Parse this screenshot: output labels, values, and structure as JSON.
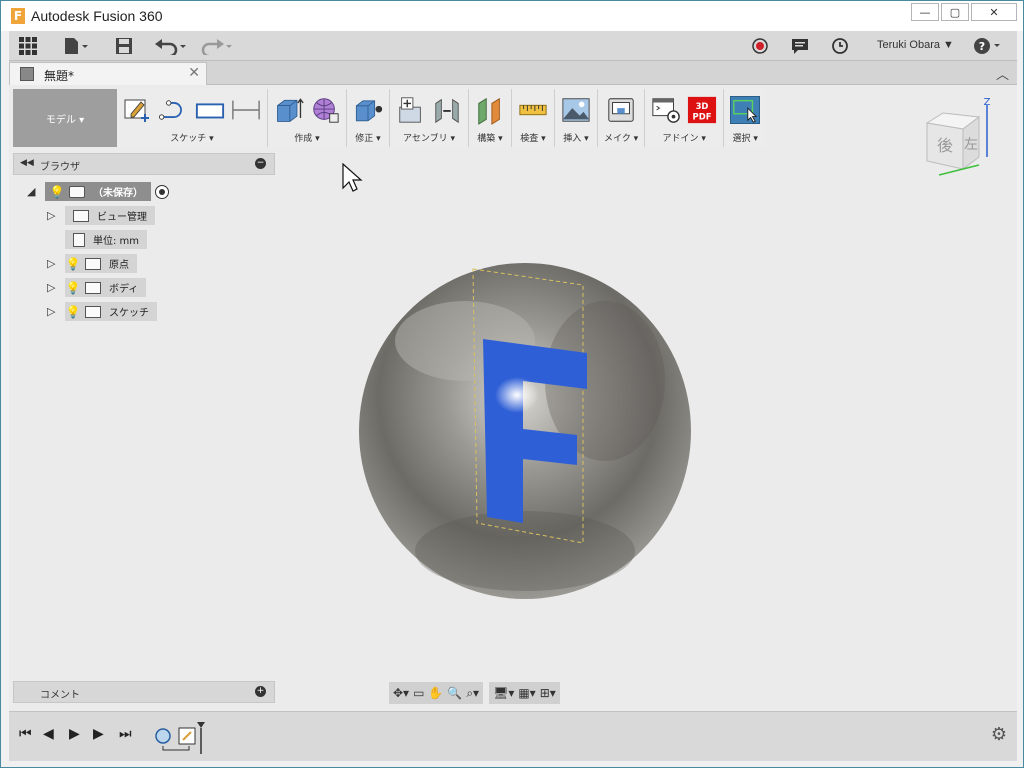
{
  "window": {
    "title": "Autodesk Fusion 360",
    "app_logo_letter": "F"
  },
  "appbar": {
    "user_name": "Teruki Obara ▼",
    "help": "?"
  },
  "tab": {
    "label": "無題*"
  },
  "toolbar": {
    "workspace": "モデル ▾",
    "groups": [
      {
        "label": "スケッチ ▾"
      },
      {
        "label": "作成 ▾"
      },
      {
        "label": "修正 ▾"
      },
      {
        "label": "アセンブリ ▾"
      },
      {
        "label": "構築 ▾"
      },
      {
        "label": "検査 ▾"
      },
      {
        "label": "挿入 ▾"
      },
      {
        "label": "メイク ▾"
      },
      {
        "label": "アドイン ▾"
      },
      {
        "label": "選択 ▾"
      }
    ],
    "pdf_badge": "3D PDF"
  },
  "viewcube": {
    "face_back": "後",
    "face_left": "左",
    "axis_z": "Z"
  },
  "browser": {
    "title": "ブラウザ",
    "root": "（未保存）",
    "items": [
      {
        "label": "ビュー管理"
      },
      {
        "label": "単位: mm"
      },
      {
        "label": "原点"
      },
      {
        "label": "ボディ"
      },
      {
        "label": "スケッチ"
      }
    ]
  },
  "comments": {
    "title": "コメント"
  },
  "model": {
    "letter": "F",
    "letter_color": "#2f5fd6",
    "sphere_color": "#8a8882"
  }
}
